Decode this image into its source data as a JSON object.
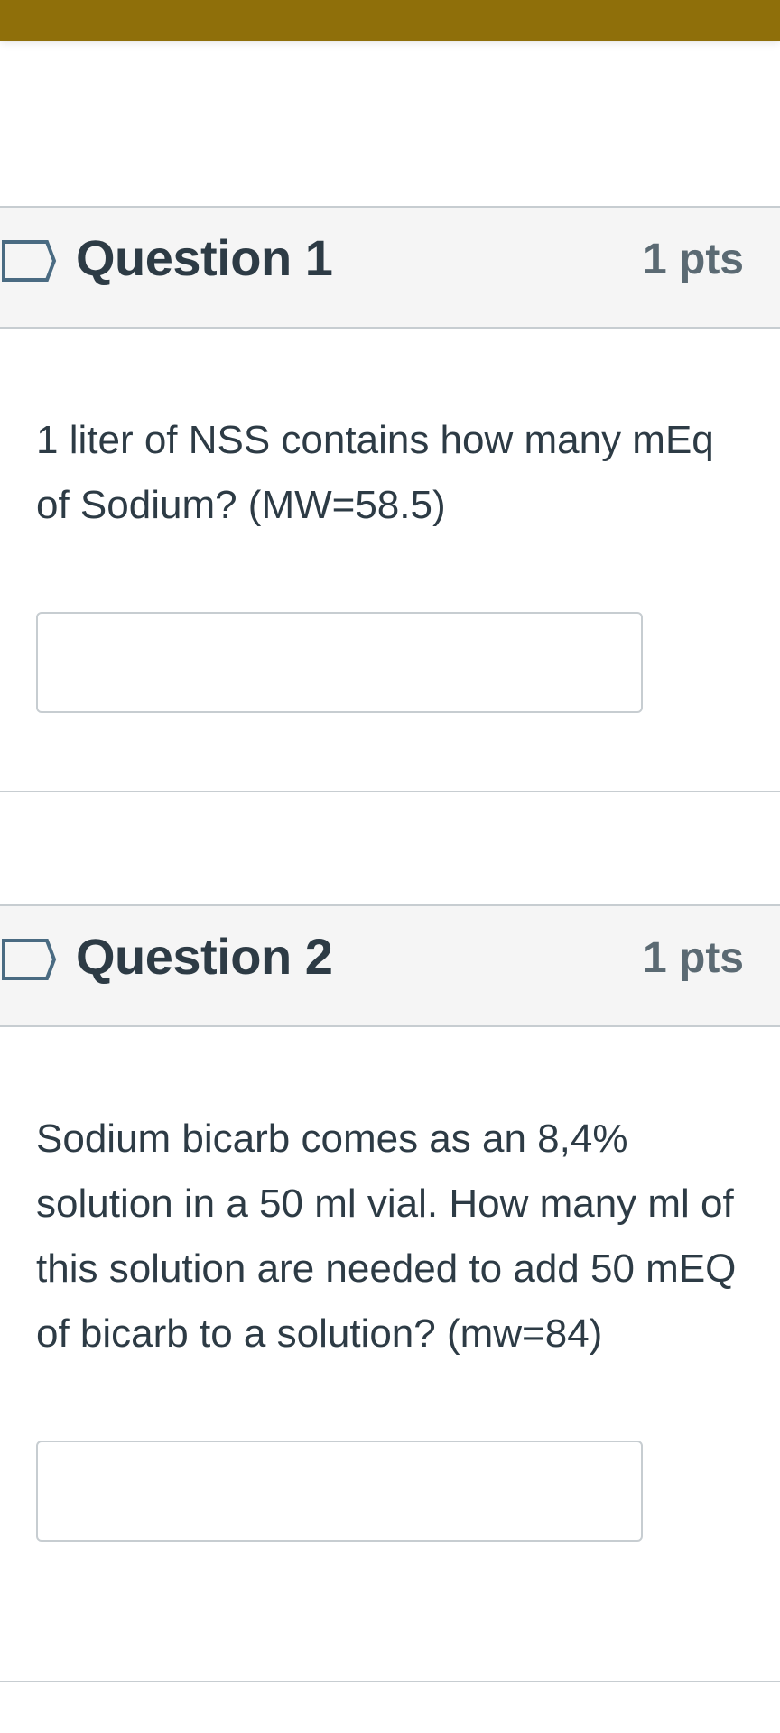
{
  "header": {
    "bar_color": "#8f6f0a"
  },
  "questions": [
    {
      "title": "Question 1",
      "points": "1 pts",
      "text": "1 liter of NSS contains how many mEq of Sodium? (MW=58.5)",
      "answer_value": ""
    },
    {
      "title": "Question 2",
      "points": "1 pts",
      "text": "Sodium bicarb comes as an 8,4% solution in a 50 ml vial.  How many ml of this solution are needed to add 50 mEQ of bicarb to a solution? (mw=84)",
      "answer_value": ""
    }
  ],
  "icons": {
    "flag": "bookmark-flag-icon"
  }
}
